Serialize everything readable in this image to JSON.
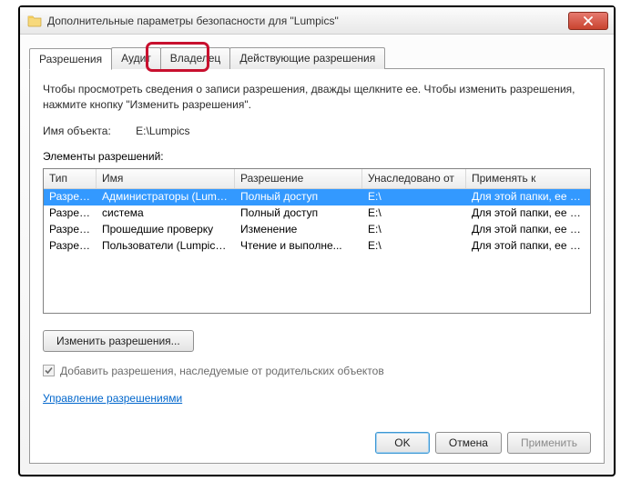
{
  "window": {
    "title": "Дополнительные параметры безопасности  для \"Lumpics\""
  },
  "tabs": {
    "items": [
      {
        "label": "Разрешения"
      },
      {
        "label": "Аудит"
      },
      {
        "label": "Владелец"
      },
      {
        "label": "Действующие разрешения"
      }
    ]
  },
  "panel": {
    "description": "Чтобы просмотреть сведения о записи разрешения, дважды щелкните ее. Чтобы изменить разрешения, нажмите кнопку \"Изменить разрешения\".",
    "object_label": "Имя объекта:",
    "object_value": "E:\\Lumpics",
    "list_label": "Элементы разрешений:",
    "columns": {
      "type": "Тип",
      "name": "Имя",
      "perm": "Разрешение",
      "inh": "Унаследовано от",
      "appl": "Применять к"
    },
    "rows": [
      {
        "type": "Разреш...",
        "name": "Администраторы (Lumpi...",
        "perm": "Полный доступ",
        "inh": "E:\\",
        "appl": "Для этой папки, ее под..."
      },
      {
        "type": "Разреш...",
        "name": "система",
        "perm": "Полный доступ",
        "inh": "E:\\",
        "appl": "Для этой папки, ее под..."
      },
      {
        "type": "Разреш...",
        "name": "Прошедшие проверку",
        "perm": "Изменение",
        "inh": "E:\\",
        "appl": "Для этой папки, ее под..."
      },
      {
        "type": "Разреш...",
        "name": "Пользователи (Lumpics-...",
        "perm": "Чтение и выполне...",
        "inh": "E:\\",
        "appl": "Для этой папки, ее под..."
      }
    ],
    "edit_btn": "Изменить разрешения...",
    "checkbox_label": "Добавить разрешения, наследуемые от родительских объектов",
    "link": "Управление разрешениями"
  },
  "buttons": {
    "ok": "OK",
    "cancel": "Отмена",
    "apply": "Применить"
  }
}
